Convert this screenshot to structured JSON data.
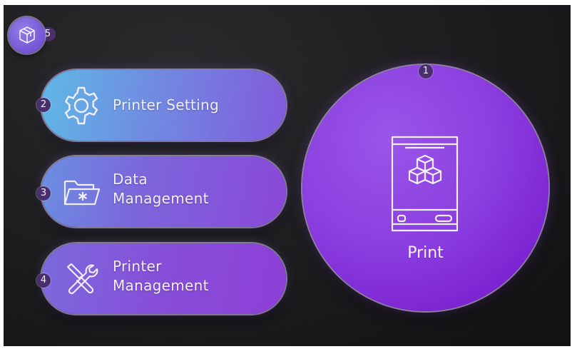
{
  "menu": {
    "print": {
      "label": "Print",
      "badge": "1",
      "icon": "printer-cube-icon"
    },
    "printer_setting": {
      "label": "Printer Setting",
      "badge": "2",
      "icon": "gear-icon"
    },
    "data_management": {
      "label_line1": "Data",
      "label_line2": "Management",
      "badge": "3",
      "icon": "folder-icon"
    },
    "printer_management": {
      "label_line1": "Printer",
      "label_line2": "Management",
      "badge": "4",
      "icon": "tools-icon"
    },
    "cube_button": {
      "badge": "5",
      "icon": "cube-icon"
    }
  },
  "colors": {
    "background": "#1c1c1e",
    "accent_purple": "#8b3fe0",
    "badge": "#4a2f6d"
  }
}
